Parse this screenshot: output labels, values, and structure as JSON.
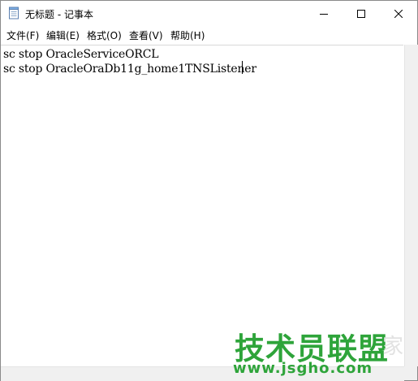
{
  "window": {
    "title": "无标题 - 记事本"
  },
  "menu": {
    "file": "文件(F)",
    "edit": "编辑(E)",
    "format": "格式(O)",
    "view": "查看(V)",
    "help": "帮助(H)"
  },
  "document": {
    "lines": [
      "sc stop OracleServiceORCL",
      "sc stop OracleOraDb11g_home1TNSListener"
    ]
  },
  "watermark": {
    "brand": "技术员联盟",
    "extra": "家",
    "url": "www.jsgho.com"
  },
  "icons": {
    "app": "notepad-icon",
    "minimize": "minimize-icon",
    "maximize": "maximize-icon",
    "close": "close-icon"
  }
}
